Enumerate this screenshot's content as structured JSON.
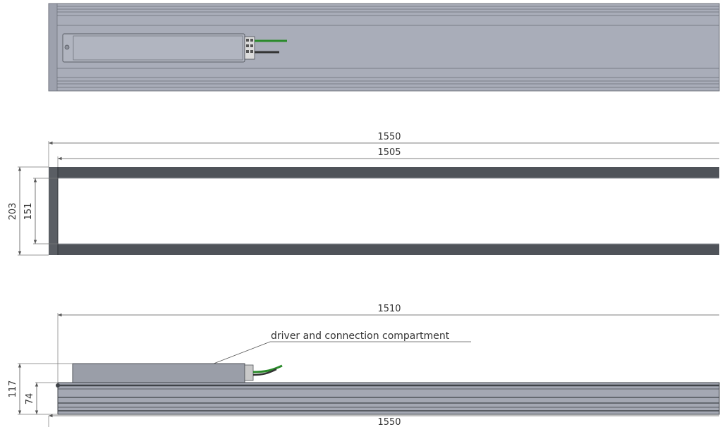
{
  "dimensions": {
    "top_overall_length": "1550",
    "top_inner_length": "1505",
    "overall_width": "203",
    "inner_width": "151",
    "side_length": "1510",
    "side_total_height": "117",
    "side_profile_height": "74",
    "bottom_length": "1550"
  },
  "annotations": {
    "compartment_label": "driver and connection compartment"
  },
  "colors": {
    "body_fill": "#a9adb9",
    "frame_dark": "#4f5359",
    "cable_green": "#2a8a2a",
    "cable_black": "#333333",
    "dimension_line": "#555555"
  }
}
